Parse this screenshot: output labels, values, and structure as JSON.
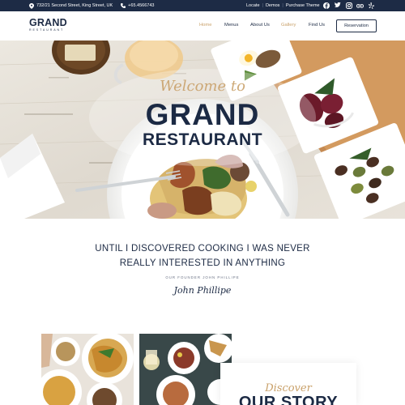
{
  "topbar": {
    "address": "732/21 Second Street, King Street, UK",
    "phone": "+65.4566743",
    "links": [
      "Locate",
      "Demos",
      "Purchase Theme"
    ],
    "socials": [
      {
        "icon": "facebook-icon",
        "glyph": "f"
      },
      {
        "icon": "twitter-icon",
        "glyph": "t"
      },
      {
        "icon": "instagram-icon",
        "glyph": "◎"
      },
      {
        "icon": "tripadvisor-icon",
        "glyph": "oo"
      },
      {
        "icon": "yelp-icon",
        "glyph": "y"
      }
    ]
  },
  "nav": {
    "logo_main": "GRAND",
    "logo_sub": "RESTAURANT",
    "items": [
      "Home",
      "Menus",
      "About Us",
      "Gallery",
      "Find Us"
    ],
    "active_items": [
      "Home",
      "Gallery"
    ],
    "reservation": "Reservation"
  },
  "hero": {
    "welcome": "Welcome to",
    "title": "GRAND",
    "subtitle": "RESTAURANT"
  },
  "intro": {
    "quote_line1": "UNTIL I DISCOVERED COOKING I WAS NEVER",
    "quote_line2": "REALLY INTERESTED IN ANYTHING",
    "founder": "OUR FOUNDER JOHN PHILLIPE",
    "signature": "John Phillipe"
  },
  "story": {
    "discover": "Discover",
    "title": "OUR STORY"
  },
  "colors": {
    "navy": "#1c2a44",
    "gold": "#c9a16a",
    "topbar": "#1d2b45"
  }
}
